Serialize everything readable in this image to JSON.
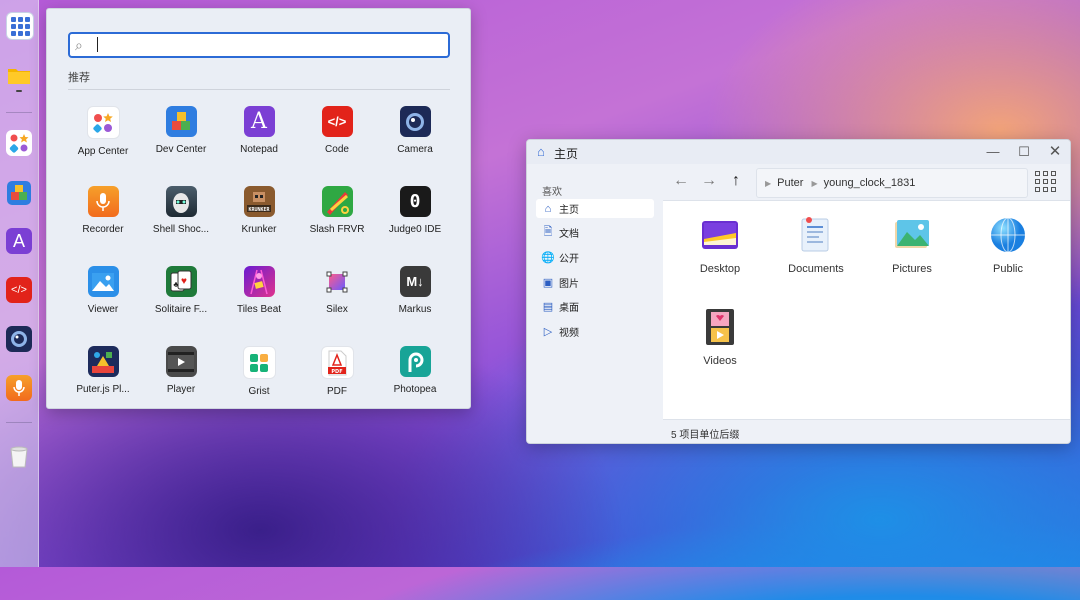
{
  "dock": {
    "items": [
      {
        "name": "app-launcher",
        "icon": "grid-icon"
      },
      {
        "name": "files",
        "icon": "folder-icon"
      },
      {
        "name": "app-center",
        "icon": "app-center-icon"
      },
      {
        "name": "dev-center",
        "icon": "dev-center-icon"
      },
      {
        "name": "notepad",
        "icon": "notepad-icon"
      },
      {
        "name": "code",
        "icon": "code-icon"
      },
      {
        "name": "camera",
        "icon": "camera-icon"
      },
      {
        "name": "recorder",
        "icon": "microphone-icon"
      },
      {
        "name": "trash",
        "icon": "trash-icon"
      }
    ]
  },
  "launcher": {
    "search_placeholder": "",
    "recommended_label": "推荐",
    "apps": [
      {
        "label": "App Center",
        "icon": "app-center-icon"
      },
      {
        "label": "Dev Center",
        "icon": "dev-center-icon"
      },
      {
        "label": "Notepad",
        "icon": "notepad-icon"
      },
      {
        "label": "Code",
        "icon": "code-icon"
      },
      {
        "label": "Camera",
        "icon": "camera-icon"
      },
      {
        "label": "Recorder",
        "icon": "microphone-icon"
      },
      {
        "label": "Shell Shoc...",
        "icon": "shell-shockers-icon"
      },
      {
        "label": "Krunker",
        "icon": "krunker-icon"
      },
      {
        "label": "Slash FRVR",
        "icon": "slash-frvr-icon"
      },
      {
        "label": "Judge0 IDE",
        "icon": "judge0-icon"
      },
      {
        "label": "Viewer",
        "icon": "image-viewer-icon"
      },
      {
        "label": "Solitaire F...",
        "icon": "solitaire-icon"
      },
      {
        "label": "Tiles Beat",
        "icon": "tiles-beat-icon"
      },
      {
        "label": "Silex",
        "icon": "silex-icon"
      },
      {
        "label": "Markus",
        "icon": "markdown-icon"
      },
      {
        "label": "Puter.js Pl...",
        "icon": "puterjs-playground-icon"
      },
      {
        "label": "Player",
        "icon": "video-player-icon"
      },
      {
        "label": "Grist",
        "icon": "grist-icon"
      },
      {
        "label": "PDF",
        "icon": "pdf-icon"
      },
      {
        "label": "Photopea",
        "icon": "photopea-icon"
      }
    ]
  },
  "explorer": {
    "title": "主页",
    "sidebar_title": "喜欢",
    "sidebar_items": [
      {
        "label": "主页",
        "icon": "home-icon",
        "active": true
      },
      {
        "label": "文档",
        "icon": "document-icon",
        "active": false
      },
      {
        "label": "公开",
        "icon": "globe-icon",
        "active": false
      },
      {
        "label": "图片",
        "icon": "image-icon",
        "active": false
      },
      {
        "label": "桌面",
        "icon": "monitor-icon",
        "active": false
      },
      {
        "label": "视频",
        "icon": "video-icon",
        "active": false
      }
    ],
    "breadcrumb": [
      "Puter",
      "young_clock_1831"
    ],
    "files": [
      {
        "label": "Desktop",
        "icon": "desktop-folder-icon"
      },
      {
        "label": "Documents",
        "icon": "documents-folder-icon"
      },
      {
        "label": "Pictures",
        "icon": "pictures-folder-icon"
      },
      {
        "label": "Public",
        "icon": "public-folder-icon"
      },
      {
        "label": "Videos",
        "icon": "videos-folder-icon"
      }
    ],
    "status": "5 项目单位后缀"
  },
  "colors": {
    "accent": "#2c6bd6",
    "window_bg": "#ffffff",
    "sidebar_bg": "#eef1f7"
  }
}
